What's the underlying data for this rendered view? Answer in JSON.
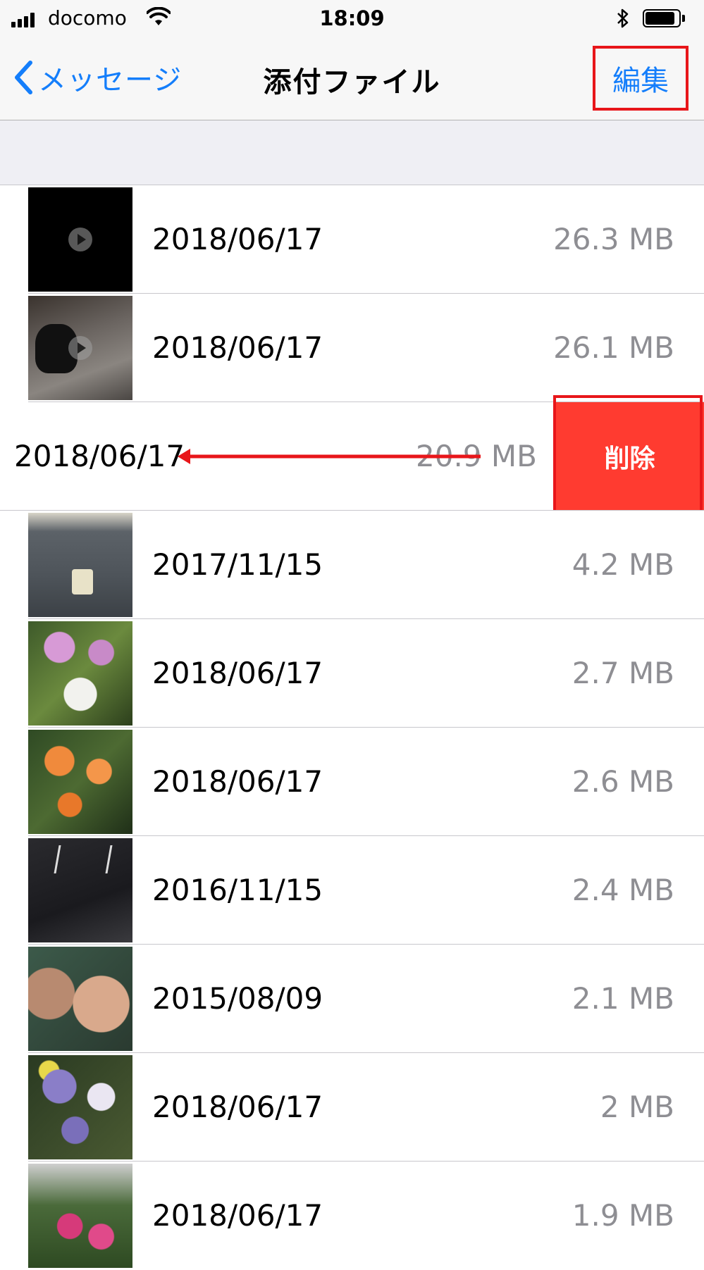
{
  "status_bar": {
    "carrier": "docomo",
    "time": "18:09",
    "signal_bars": 4,
    "battery_level": 0.9,
    "icons": [
      "signal-icon",
      "wifi-icon",
      "bluetooth-icon",
      "battery-icon"
    ]
  },
  "nav": {
    "back_label": "メッセージ",
    "title": "添付ファイル",
    "edit_label": "編集"
  },
  "attachments": [
    {
      "date": "2018/06/17",
      "size": "26.3 MB",
      "video": true
    },
    {
      "date": "2018/06/17",
      "size": "26.1 MB",
      "video": true
    },
    {
      "date": "2018/06/17",
      "size": "20.9 MB",
      "swiped": true
    },
    {
      "date": "2017/11/15",
      "size": "4.2 MB"
    },
    {
      "date": "2018/06/17",
      "size": "2.7 MB"
    },
    {
      "date": "2018/06/17",
      "size": "2.6 MB"
    },
    {
      "date": "2016/11/15",
      "size": "2.4 MB"
    },
    {
      "date": "2015/08/09",
      "size": "2.1 MB"
    },
    {
      "date": "2018/06/17",
      "size": "2 MB"
    },
    {
      "date": "2018/06/17",
      "size": "1.9 MB"
    }
  ],
  "swipe_action": {
    "label": "削除",
    "color": "#ff3b30"
  },
  "colors": {
    "accent": "#147efb",
    "annotation": "#e8161a",
    "delete": "#ff3b30",
    "secondary_text": "#8e8e93"
  }
}
